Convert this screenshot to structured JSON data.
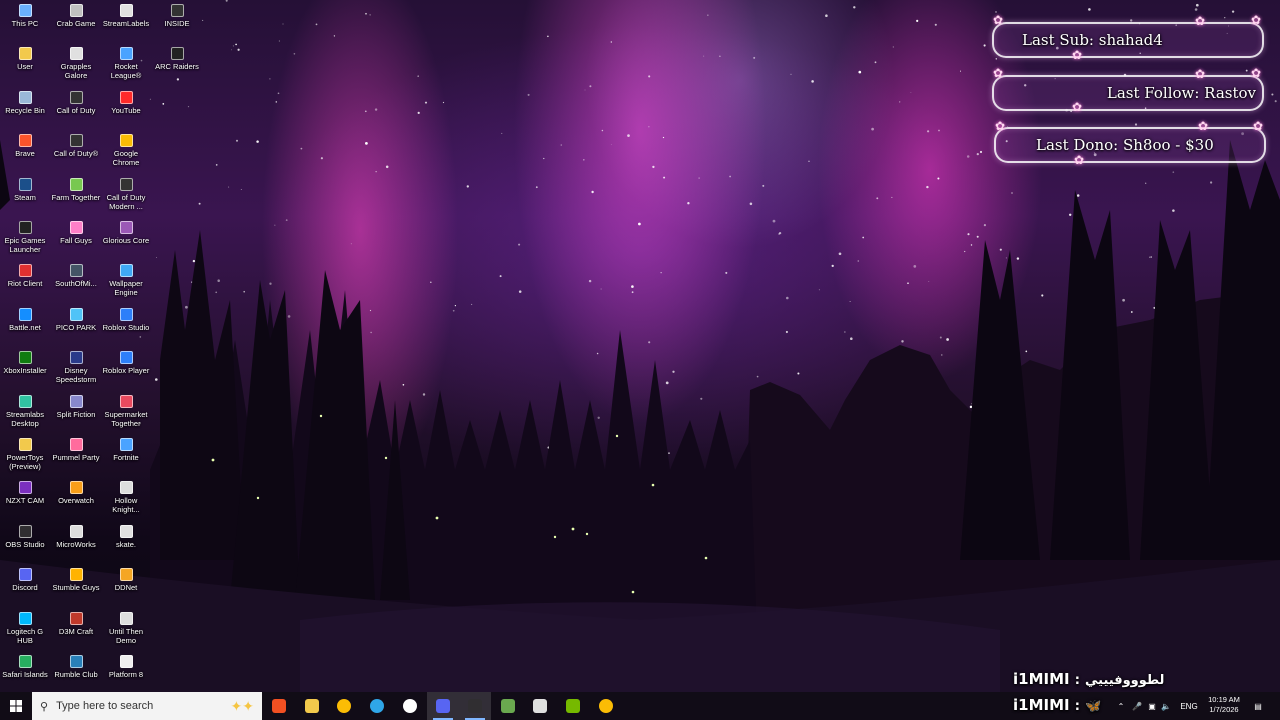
{
  "desktop": {
    "icons": [
      {
        "label": "This PC",
        "col": 0,
        "row": 0,
        "icon": "pc-icon",
        "color": "#6ab0ff"
      },
      {
        "label": "Crab Game",
        "col": 1,
        "row": 0,
        "icon": "crab-game-icon",
        "color": "#c0c0c0"
      },
      {
        "label": "StreamLabels",
        "col": 2,
        "row": 0,
        "icon": "streamlabels-icon",
        "color": "#e0e0e0"
      },
      {
        "label": "INSIDE",
        "col": 3,
        "row": 0,
        "icon": "inside-icon",
        "color": "#333333"
      },
      {
        "label": "User",
        "col": 0,
        "row": 1,
        "icon": "user-folder-icon",
        "color": "#f2c94c"
      },
      {
        "label": "Grapples Galore",
        "col": 1,
        "row": 1,
        "icon": "grapples-icon",
        "color": "#e0e0e0"
      },
      {
        "label": "Rocket League®",
        "col": 2,
        "row": 1,
        "icon": "rocket-league-icon",
        "color": "#4aa3ff"
      },
      {
        "label": "ARC Raiders",
        "col": 3,
        "row": 1,
        "icon": "arc-raiders-icon",
        "color": "#222222"
      },
      {
        "label": "Recycle Bin",
        "col": 0,
        "row": 2,
        "icon": "recycle-bin-icon",
        "color": "#9ab8d8"
      },
      {
        "label": "Call of Duty",
        "col": 1,
        "row": 2,
        "icon": "cod-icon",
        "color": "#333333"
      },
      {
        "label": "YouTube",
        "col": 2,
        "row": 2,
        "icon": "youtube-icon",
        "color": "#ff2a2a"
      },
      {
        "label": "Brave",
        "col": 0,
        "row": 3,
        "icon": "brave-icon",
        "color": "#fb542b"
      },
      {
        "label": "Call of Duty®",
        "col": 1,
        "row": 3,
        "icon": "cod-icon",
        "color": "#333333"
      },
      {
        "label": "Google Chrome",
        "col": 2,
        "row": 3,
        "icon": "chrome-icon",
        "color": "#fbbc05"
      },
      {
        "label": "Steam",
        "col": 0,
        "row": 4,
        "icon": "steam-icon",
        "color": "#1b4f8a"
      },
      {
        "label": "Farm Together",
        "col": 1,
        "row": 4,
        "icon": "farm-together-icon",
        "color": "#78c850"
      },
      {
        "label": "Call of Duty Modern ...",
        "col": 2,
        "row": 4,
        "icon": "cod-icon",
        "color": "#333333"
      },
      {
        "label": "Epic Games Launcher",
        "col": 0,
        "row": 5,
        "icon": "epic-games-icon",
        "color": "#222222"
      },
      {
        "label": "Fall Guys",
        "col": 1,
        "row": 5,
        "icon": "fall-guys-icon",
        "color": "#ff7fc8"
      },
      {
        "label": "Glorious Core",
        "col": 2,
        "row": 5,
        "icon": "glorious-core-icon",
        "color": "#9b59b6"
      },
      {
        "label": "Riot Client",
        "col": 0,
        "row": 6,
        "icon": "riot-client-icon",
        "color": "#e03030"
      },
      {
        "label": "SouthOfMi...",
        "col": 1,
        "row": 6,
        "icon": "south-of-midnight-icon",
        "color": "#445566"
      },
      {
        "label": "Wallpaper Engine",
        "col": 2,
        "row": 6,
        "icon": "wallpaper-engine-icon",
        "color": "#3fa9f5"
      },
      {
        "label": "Battle.net",
        "col": 0,
        "row": 7,
        "icon": "battlenet-icon",
        "color": "#148eff"
      },
      {
        "label": "PICO PARK",
        "col": 1,
        "row": 7,
        "icon": "pico-park-icon",
        "color": "#4fc3f7"
      },
      {
        "label": "Roblox Studio",
        "col": 2,
        "row": 7,
        "icon": "roblox-studio-icon",
        "color": "#2d7ff9"
      },
      {
        "label": "XboxInstaller",
        "col": 0,
        "row": 8,
        "icon": "xbox-icon",
        "color": "#107c10"
      },
      {
        "label": "Disney Speedstorm",
        "col": 1,
        "row": 8,
        "icon": "disney-speedstorm-icon",
        "color": "#2a3a8a"
      },
      {
        "label": "Roblox Player",
        "col": 2,
        "row": 8,
        "icon": "roblox-player-icon",
        "color": "#2d7ff9"
      },
      {
        "label": "Streamlabs Desktop",
        "col": 0,
        "row": 9,
        "icon": "streamlabs-icon",
        "color": "#31c3a2"
      },
      {
        "label": "Split Fiction",
        "col": 1,
        "row": 9,
        "icon": "split-fiction-icon",
        "color": "#8888cc"
      },
      {
        "label": "Supermarket Together",
        "col": 2,
        "row": 9,
        "icon": "supermarket-together-icon",
        "color": "#e84a5f"
      },
      {
        "label": "PowerToys (Preview)",
        "col": 0,
        "row": 10,
        "icon": "powertoys-icon",
        "color": "#f2c94c"
      },
      {
        "label": "Pummel Party",
        "col": 1,
        "row": 10,
        "icon": "pummel-party-icon",
        "color": "#ff6b9d"
      },
      {
        "label": "Fortnite",
        "col": 2,
        "row": 10,
        "icon": "fortnite-icon",
        "color": "#4aa3ff"
      },
      {
        "label": "NZXT CAM",
        "col": 0,
        "row": 11,
        "icon": "nzxt-cam-icon",
        "color": "#7b2fbf"
      },
      {
        "label": "Overwatch",
        "col": 1,
        "row": 11,
        "icon": "overwatch-icon",
        "color": "#f99e1a"
      },
      {
        "label": "Hollow Knight...",
        "col": 2,
        "row": 11,
        "icon": "hollow-knight-icon",
        "color": "#dddddd"
      },
      {
        "label": "OBS Studio",
        "col": 0,
        "row": 12,
        "icon": "obs-icon",
        "color": "#302e31"
      },
      {
        "label": "MicroWorks",
        "col": 1,
        "row": 12,
        "icon": "microworks-icon",
        "color": "#dddddd"
      },
      {
        "label": "skate.",
        "col": 2,
        "row": 12,
        "icon": "skate-icon",
        "color": "#e0e0e0"
      },
      {
        "label": "Discord",
        "col": 0,
        "row": 13,
        "icon": "discord-icon",
        "color": "#5865f2"
      },
      {
        "label": "Stumble Guys",
        "col": 1,
        "row": 13,
        "icon": "stumble-guys-icon",
        "color": "#ffb300"
      },
      {
        "label": "DDNet",
        "col": 2,
        "row": 13,
        "icon": "ddnet-icon",
        "color": "#f5a623"
      },
      {
        "label": "Logitech G HUB",
        "col": 0,
        "row": 14,
        "icon": "logitech-ghub-icon",
        "color": "#00b8fc"
      },
      {
        "label": "D3M Craft",
        "col": 1,
        "row": 14,
        "icon": "d3m-craft-icon",
        "color": "#c0392b"
      },
      {
        "label": "Until Then Demo",
        "col": 2,
        "row": 14,
        "icon": "until-then-icon",
        "color": "#dddddd"
      },
      {
        "label": "Safari Islands",
        "col": 0,
        "row": 15,
        "icon": "safari-islands-icon",
        "color": "#27ae60"
      },
      {
        "label": "Rumble Club",
        "col": 1,
        "row": 15,
        "icon": "rumble-club-icon",
        "color": "#2980b9"
      },
      {
        "label": "Platform 8",
        "col": 2,
        "row": 15,
        "icon": "platform-8-icon",
        "color": "#eeeeee"
      }
    ]
  },
  "overlay": {
    "last_sub": "Last Sub: shahad4",
    "last_follow": "Last Follow: Rastov",
    "last_dono": "Last Dono: Sh8oo - $30",
    "flower_color": "#ffd6f0"
  },
  "chat": {
    "line1_user": "i1MIMI",
    "line1_sep": ":",
    "line1_msg": "لطوووفيييي",
    "line2_user": "i1MIMI",
    "line2_sep": ":",
    "line2_icon": "bluesky-butterfly-icon"
  },
  "taskbar": {
    "search_placeholder": "Type here to search",
    "apps": [
      {
        "name": "microsoft-store-icon",
        "color": "#f25022",
        "active": false
      },
      {
        "name": "file-explorer-icon",
        "color": "#f2c94c",
        "active": false
      },
      {
        "name": "chrome-icon",
        "color": "#fbbc05",
        "active": false
      },
      {
        "name": "edge-icon",
        "color": "#2fa6e8",
        "active": false
      },
      {
        "name": "settings-icon",
        "color": "#ffffff",
        "active": false
      },
      {
        "name": "discord-icon",
        "color": "#5865f2",
        "active": true
      },
      {
        "name": "obs-icon",
        "color": "#302e31",
        "active": true
      },
      {
        "name": "minecraft-icon",
        "color": "#6aa84f",
        "active": false
      },
      {
        "name": "cube-app-icon",
        "color": "#e0e0e0",
        "active": false
      },
      {
        "name": "nvidia-icon",
        "color": "#76b900",
        "active": false
      },
      {
        "name": "chrome-icon",
        "color": "#fbbc05",
        "active": false
      }
    ],
    "tray_lang": "ENG",
    "time": "10:19 AM",
    "date": "1/7/2026"
  }
}
